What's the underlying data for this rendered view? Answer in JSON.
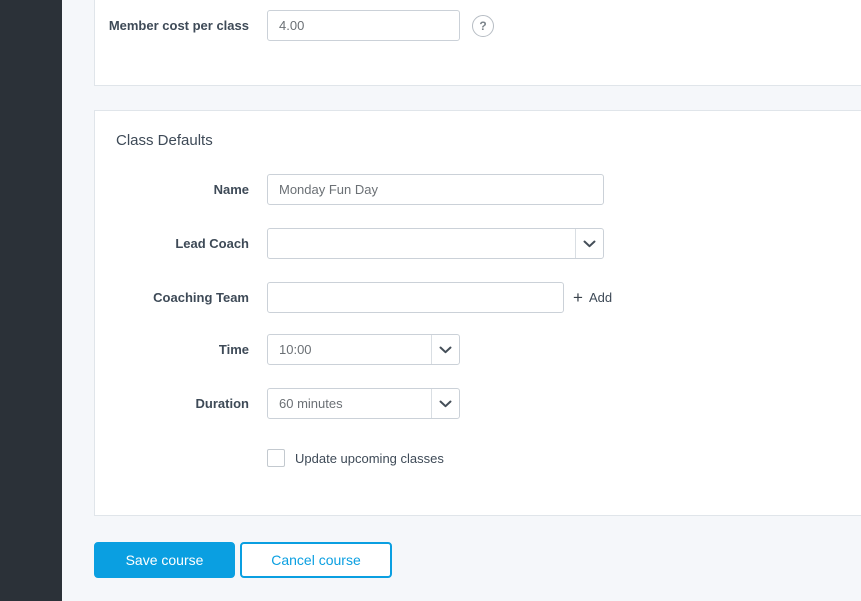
{
  "theme": {
    "accent_blue": "#0a9fe1",
    "sidebar_bg": "#2b3138",
    "page_bg": "#f5f7fa"
  },
  "pricing": {
    "member_cost": {
      "label": "Member cost per class",
      "value": "4.00"
    },
    "help_glyph": "?"
  },
  "class_defaults": {
    "heading": "Class Defaults",
    "name": {
      "label": "Name",
      "value": "Monday Fun Day"
    },
    "lead_coach": {
      "label": "Lead Coach",
      "value": ""
    },
    "coaching_team": {
      "label": "Coaching Team",
      "value": "",
      "add_plus": "+",
      "add_label": "Add"
    },
    "time": {
      "label": "Time",
      "value": "10:00"
    },
    "duration": {
      "label": "Duration",
      "value": "60 minutes"
    },
    "update_checkbox": {
      "label": "Update upcoming classes",
      "checked": false
    }
  },
  "actions": {
    "save_label": "Save course",
    "cancel_label": "Cancel course"
  }
}
